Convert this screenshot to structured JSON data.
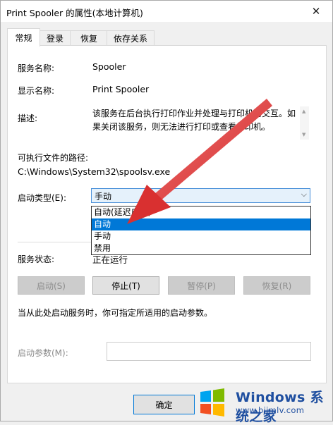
{
  "window": {
    "title": "Print Spooler 的属性(本地计算机)",
    "close_symbol": "✕"
  },
  "tabs": [
    {
      "label": "常规",
      "active": true
    },
    {
      "label": "登录",
      "active": false
    },
    {
      "label": "恢复",
      "active": false
    },
    {
      "label": "依存关系",
      "active": false
    }
  ],
  "general": {
    "service_name_label": "服务名称:",
    "service_name_value": "Spooler",
    "display_name_label": "显示名称:",
    "display_name_value": "Print Spooler",
    "description_label": "描述:",
    "description_value": "该服务在后台执行打印作业并处理与打印机的交互。如果关闭该服务，则无法进行打印或查看打印机。",
    "exec_path_label": "可执行文件的路径:",
    "exec_path_value": "C:\\Windows\\System32\\spoolsv.exe",
    "startup_type_label": "启动类型(E):",
    "startup_type_value": "手动",
    "startup_options": [
      {
        "label": "自动(延迟启动)",
        "selected": false
      },
      {
        "label": "自动",
        "selected": true
      },
      {
        "label": "手动",
        "selected": false
      },
      {
        "label": "禁用",
        "selected": false
      }
    ],
    "service_status_label": "服务状态:",
    "service_status_value": "正在运行",
    "buttons": {
      "start": "启动(S)",
      "stop": "停止(T)",
      "pause": "暂停(P)",
      "resume": "恢复(R)"
    },
    "hint_text": "当从此处启动服务时，你可指定所适用的启动参数。",
    "start_params_label": "启动参数(M):",
    "start_params_value": ""
  },
  "footer": {
    "ok_label": "确定"
  },
  "watermark": {
    "brand": "Windows",
    "brand_cn": "系统之家",
    "url": "www.bjjmlv.com"
  },
  "colors": {
    "accent": "#0078d7",
    "arrow": "#e03c3c",
    "watermark": "#1f4fa0"
  }
}
